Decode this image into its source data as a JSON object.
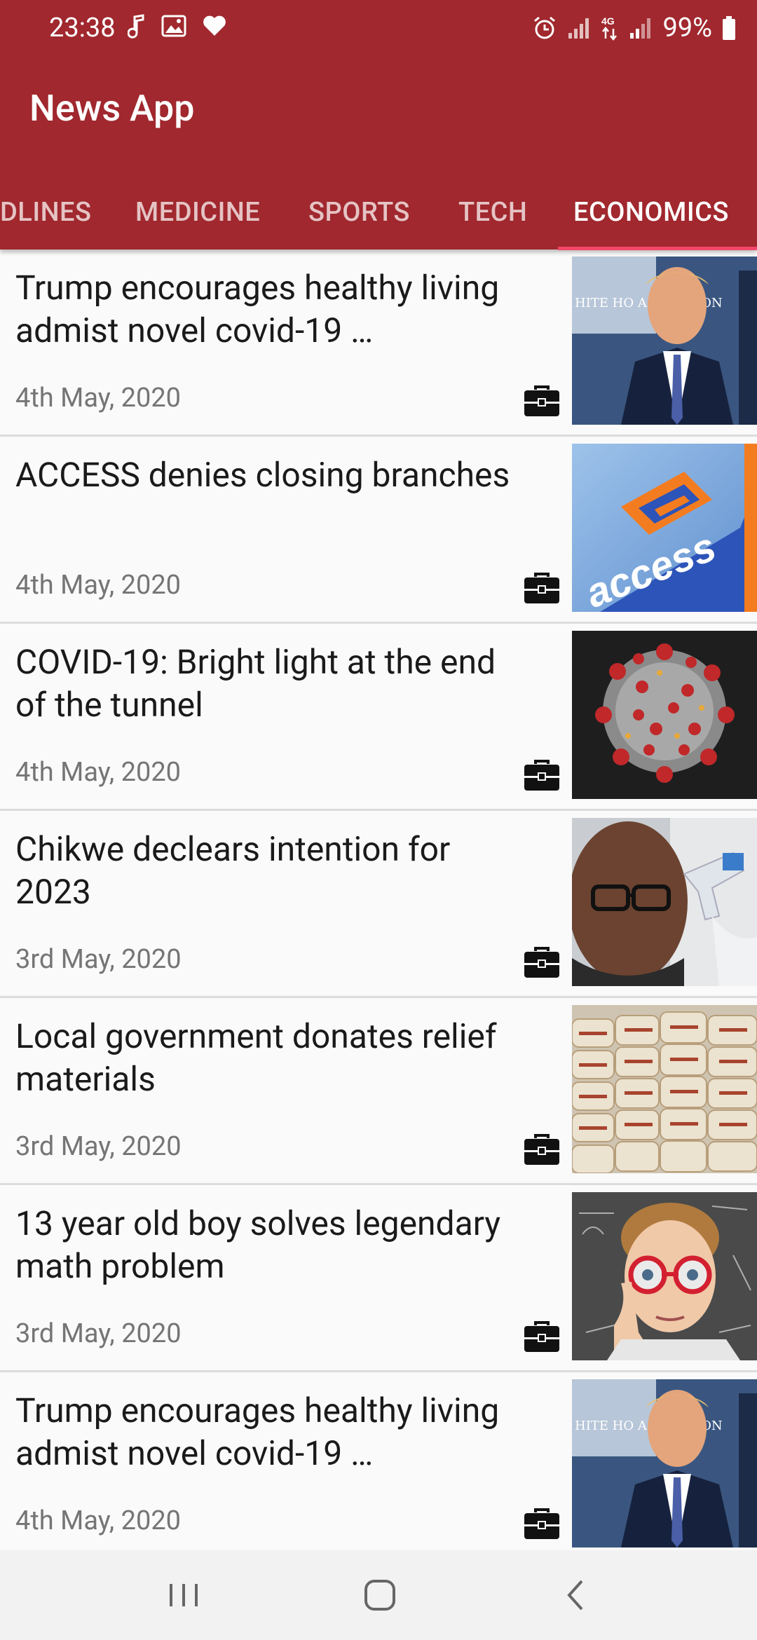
{
  "status": {
    "time": "23:38",
    "battery": "99%",
    "network": "4G"
  },
  "app": {
    "title": "News App"
  },
  "tabs": [
    {
      "label": "DLINES"
    },
    {
      "label": "MEDICINE"
    },
    {
      "label": "SPORTS"
    },
    {
      "label": "TECH"
    },
    {
      "label": "ECONOMICS",
      "active": true
    }
  ],
  "articles": [
    {
      "title": "Trump encourages healthy living admist novel covid-19 …",
      "date": "4th May, 2020",
      "image": "trump-photo",
      "image_text": "HITE HO\nASHINGTON"
    },
    {
      "title": "ACCESS denies closing branches",
      "date": "4th May, 2020",
      "image": "access-bank-logo",
      "image_text": "access"
    },
    {
      "title": "COVID-19: Bright light at the end of the tunnel",
      "date": "4th May, 2020",
      "image": "coronavirus-photo"
    },
    {
      "title": "Chikwe declears intention for 2023",
      "date": "3rd May, 2020",
      "image": "man-thermometer-photo"
    },
    {
      "title": "Local government donates relief materials",
      "date": "3rd May, 2020",
      "image": "rice-bags-photo"
    },
    {
      "title": "13 year old boy solves legendary math problem",
      "date": "3rd May, 2020",
      "image": "boy-glasses-photo"
    },
    {
      "title": "Trump encourages healthy living admist novel covid-19 …",
      "date": "4th May, 2020",
      "image": "trump-photo",
      "image_text": "HITE HO\nASHINGTON"
    }
  ],
  "colors": {
    "primary": "#a0282e",
    "indicator": "#f4466a",
    "background": "#fafafa"
  }
}
